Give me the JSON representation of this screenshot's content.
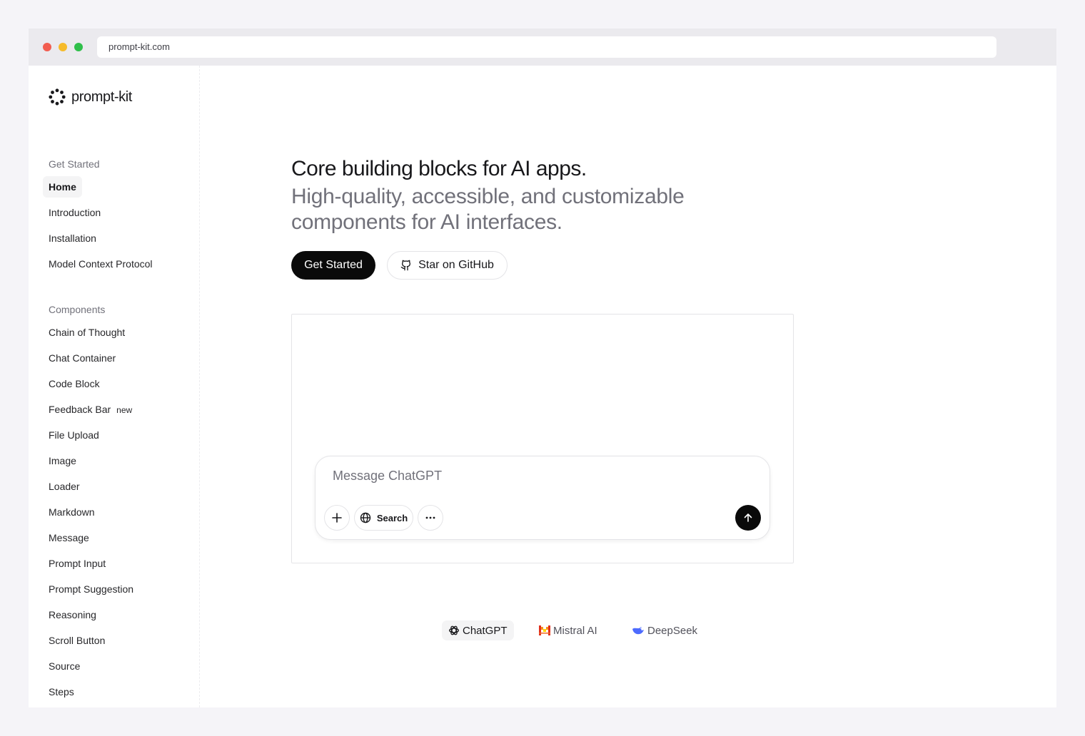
{
  "browser": {
    "url": "prompt-kit.com"
  },
  "brand": {
    "name": "prompt-kit",
    "icon": "logo-ring-icon"
  },
  "sidebar": {
    "groups": [
      {
        "label": "Get Started",
        "items": [
          {
            "label": "Home",
            "active": true
          },
          {
            "label": "Introduction"
          },
          {
            "label": "Installation"
          },
          {
            "label": "Model Context Protocol"
          }
        ]
      },
      {
        "label": "Components",
        "items": [
          {
            "label": "Chain of Thought"
          },
          {
            "label": "Chat Container"
          },
          {
            "label": "Code Block"
          },
          {
            "label": "Feedback Bar",
            "badge": "new"
          },
          {
            "label": "File Upload"
          },
          {
            "label": "Image"
          },
          {
            "label": "Loader"
          },
          {
            "label": "Markdown"
          },
          {
            "label": "Message"
          },
          {
            "label": "Prompt Input"
          },
          {
            "label": "Prompt Suggestion"
          },
          {
            "label": "Reasoning"
          },
          {
            "label": "Scroll Button"
          },
          {
            "label": "Source"
          },
          {
            "label": "Steps"
          }
        ]
      }
    ]
  },
  "hero": {
    "title": "Core building blocks for AI apps.",
    "subtitle": "High-quality, accessible, and customizable components for AI interfaces.",
    "primary_cta": "Get Started",
    "secondary_cta": "Star on GitHub"
  },
  "demo": {
    "prompt_placeholder": "Message ChatGPT",
    "prompt_value": "",
    "search_label": "Search",
    "model_tabs": [
      {
        "label": "ChatGPT",
        "icon": "openai-icon",
        "active": true
      },
      {
        "label": "Mistral AI",
        "icon": "mistral-icon"
      },
      {
        "label": "DeepSeek",
        "icon": "deepseek-icon"
      }
    ]
  },
  "colors": {
    "accent": "#0a0a0a",
    "muted_text": "#71717a",
    "border": "#e4e4e7",
    "mistral": "#f7941d",
    "deepseek": "#4d6bfe"
  }
}
